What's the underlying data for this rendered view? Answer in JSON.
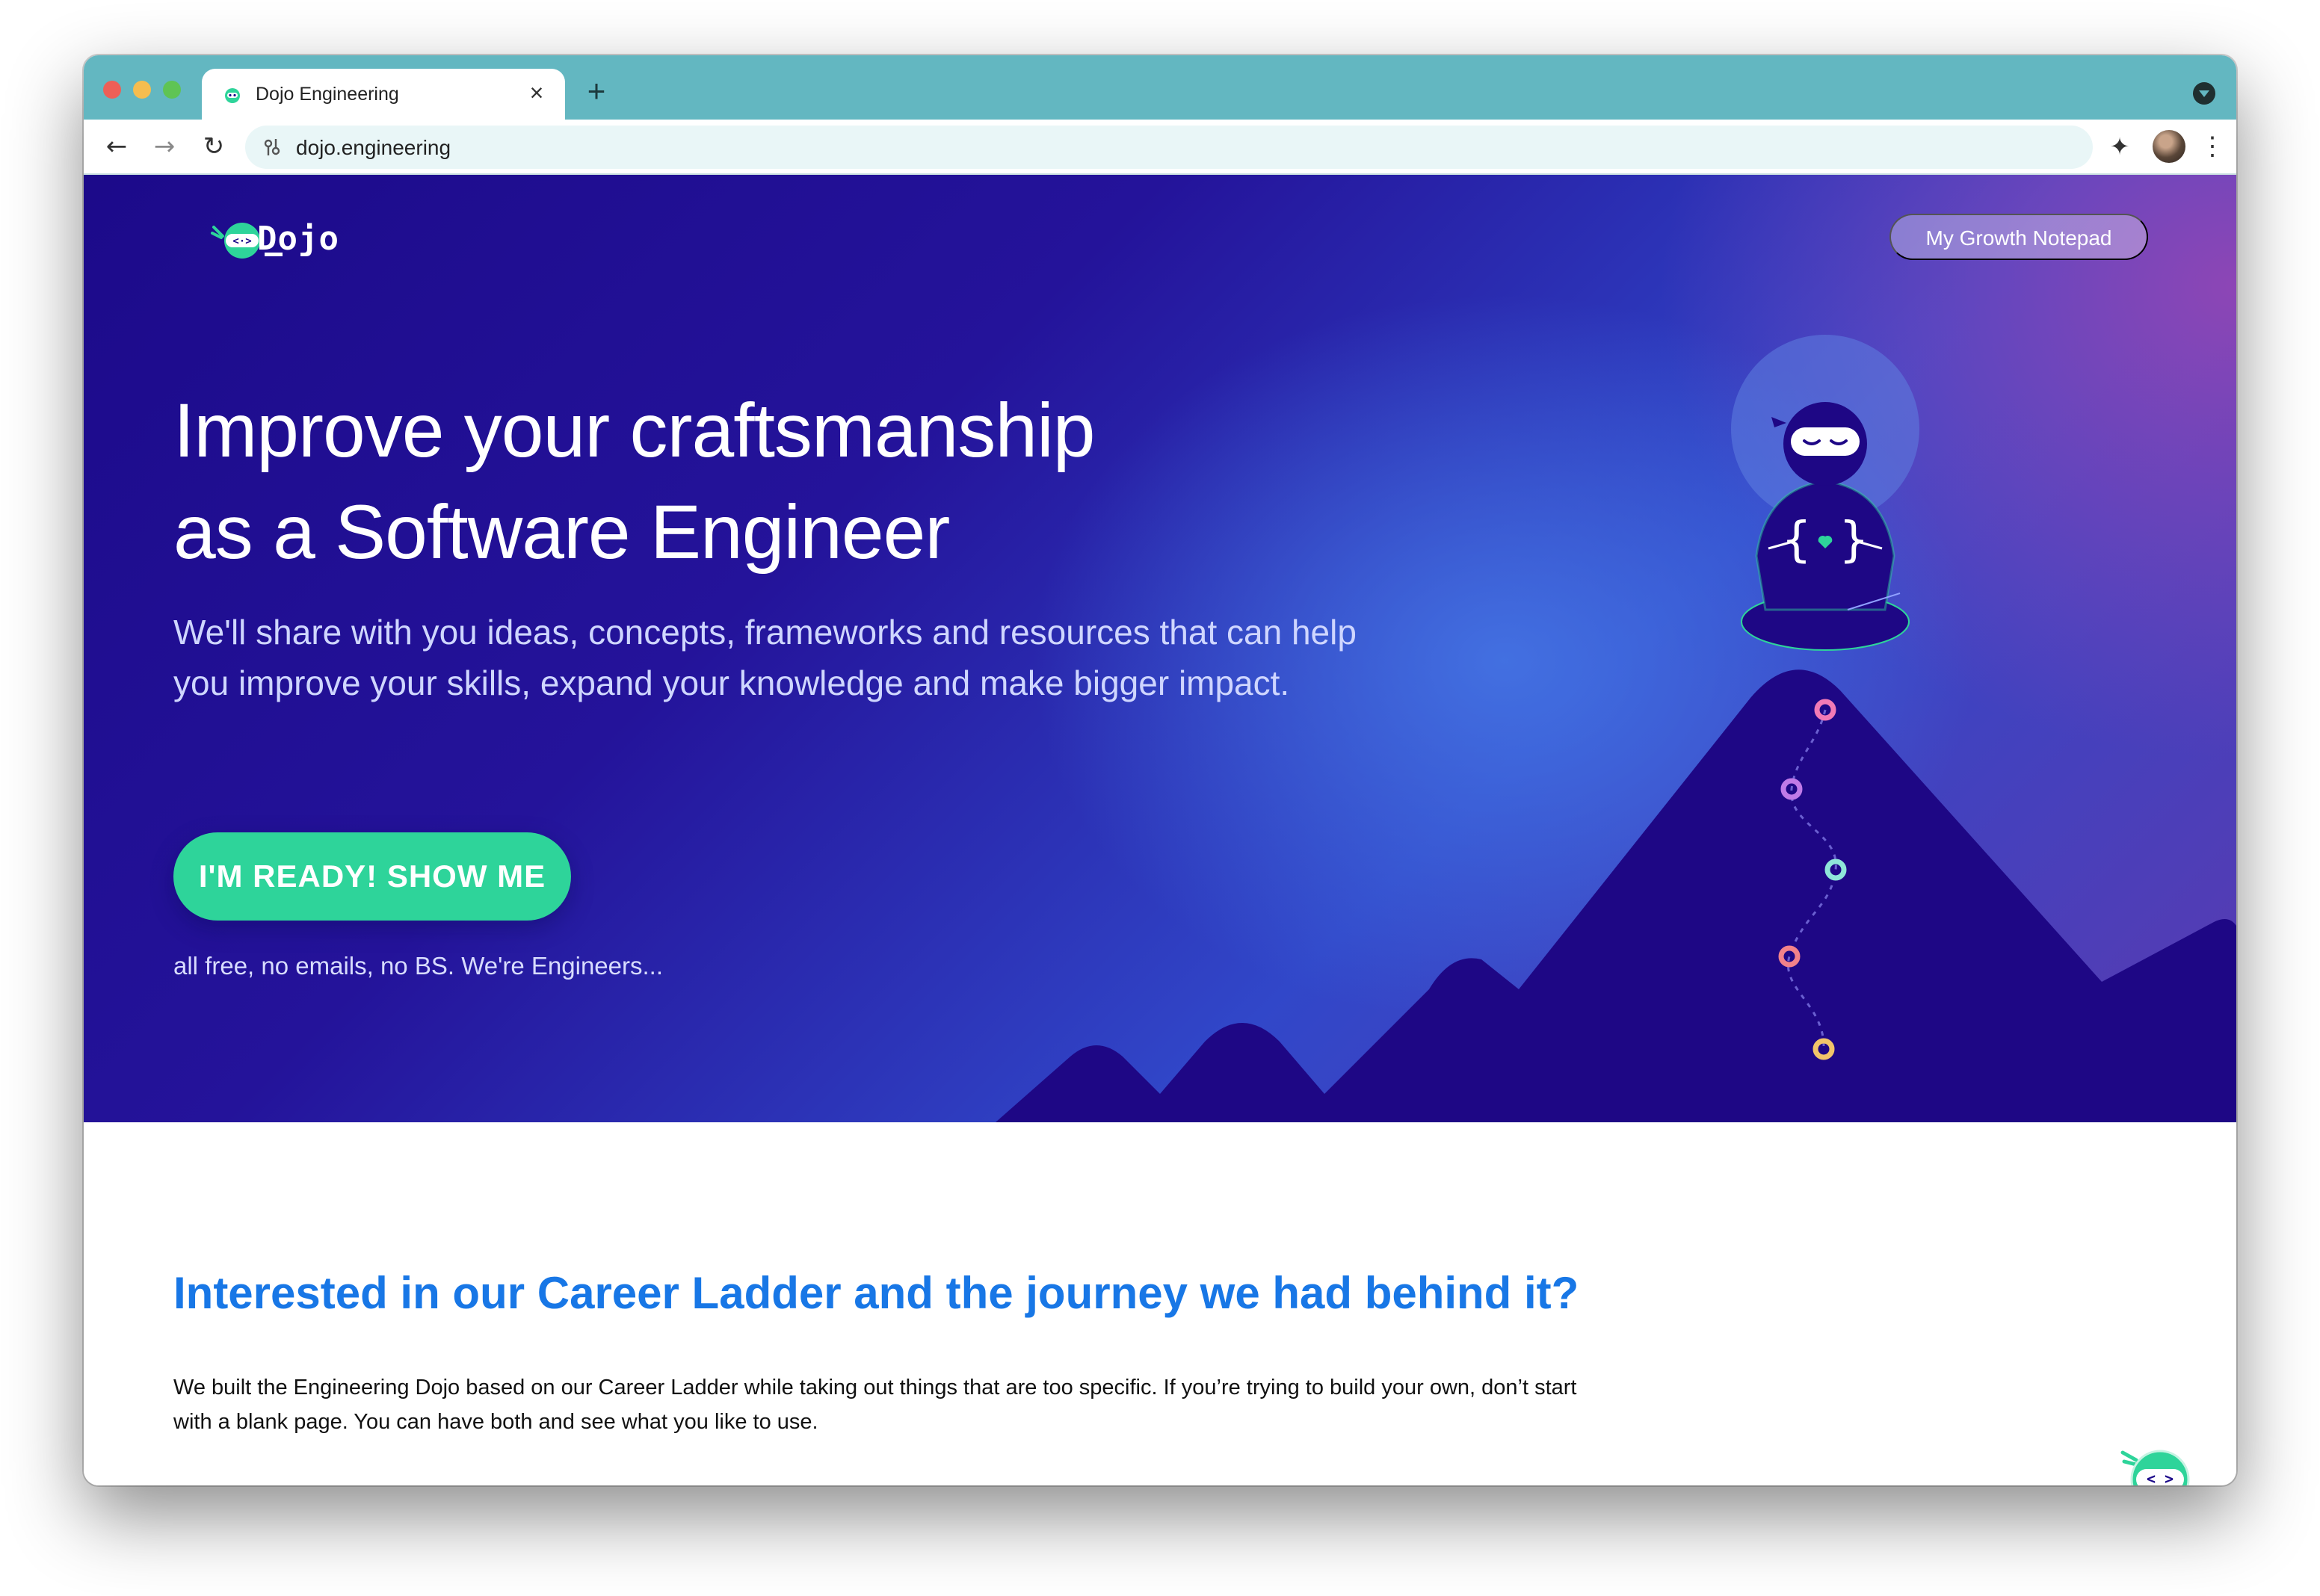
{
  "browser": {
    "tab_title": "Dojo Engineering",
    "tab_close_icon": "close-icon",
    "new_tab_label": "+",
    "url": "dojo.engineering",
    "back_label": "←",
    "forward_label": "→",
    "reload_label": "↻",
    "menu_label": "⋮",
    "extensions_label": "✦"
  },
  "header": {
    "logo_text": "Dojo",
    "notepad_button": "My Growth Notepad"
  },
  "hero": {
    "title_line1": "Improve your craftsmanship",
    "title_line2": "as a Software Engineer",
    "subtitle_line1": "We'll share with you ideas, concepts, frameworks and resources that can help",
    "subtitle_line2": "you improve your skills, expand your knowledge and make bigger impact.",
    "cta_button": "I'M READY! SHOW ME",
    "cta_note": "all free, no emails, no BS. We're Engineers...",
    "path_dot_colors": [
      "#f27ab6",
      "#c07ae8",
      "#8fe6d9",
      "#f2828a",
      "#f2c46a"
    ]
  },
  "career": {
    "heading": "Interested in our Career Ladder and the journey we had behind it?",
    "text_line1": "We built the Engineering Dojo based on our Career Ladder while taking out things that are too specific. If you’re trying to build your own, don’t start",
    "text_line2": "with a blank page. You can have both and see what you like to use."
  },
  "colors": {
    "tab_strip": "#63b7c1",
    "hero_dark": "#1c0a8a",
    "accent_green": "#2ed49a",
    "heading_blue": "#1877e6"
  }
}
